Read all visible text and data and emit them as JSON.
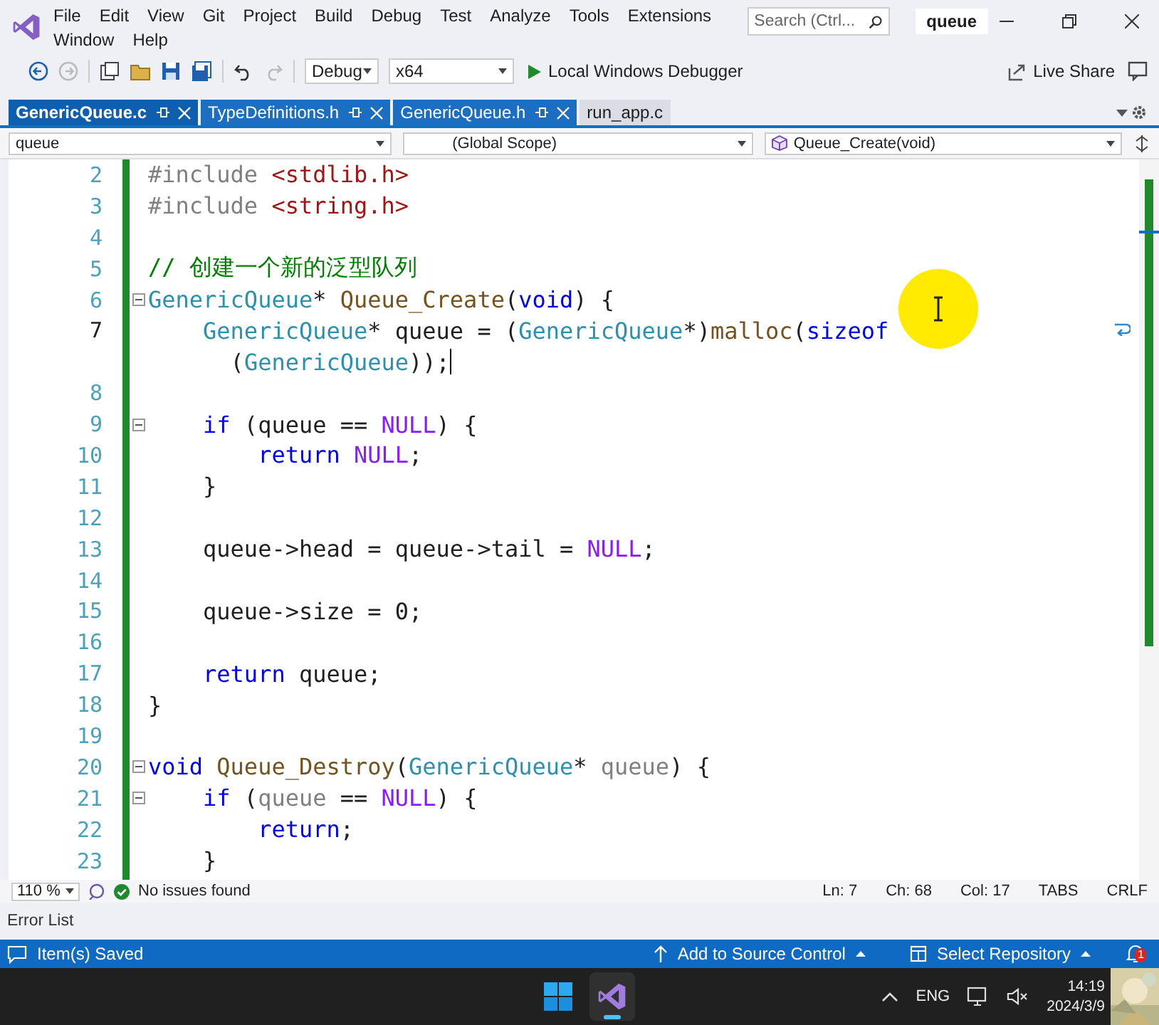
{
  "menu": [
    "File",
    "Edit",
    "View",
    "Git",
    "Project",
    "Build",
    "Debug",
    "Test",
    "Analyze",
    "Tools",
    "Extensions",
    "Window",
    "Help"
  ],
  "search": {
    "placeholder": "Search (Ctrl..."
  },
  "window": {
    "title": "queue"
  },
  "toolbar": {
    "configuration": "Debug",
    "platform": "x64",
    "run_label": "Local Windows Debugger",
    "live_share": "Live Share"
  },
  "tabs": [
    {
      "label": "GenericQueue.c",
      "selected": true,
      "pinned": true
    },
    {
      "label": "TypeDefinitions.h",
      "selected": false,
      "pinned": true
    },
    {
      "label": "GenericQueue.h",
      "selected": false,
      "pinned": true
    },
    {
      "label": "run_app.c",
      "selected": false,
      "pinned": false
    }
  ],
  "nav": {
    "project": "queue",
    "scope": "(Global Scope)",
    "member": "Queue_Create(void)"
  },
  "code": [
    {
      "number": "2",
      "tokens": [
        {
          "kind": "pp",
          "text": "#include"
        },
        {
          "kind": "str",
          "text": " <stdlib.h>"
        }
      ]
    },
    {
      "number": "3",
      "tokens": [
        {
          "kind": "pp",
          "text": "#include"
        },
        {
          "kind": "str",
          "text": " <string.h>"
        }
      ]
    },
    {
      "number": "4"
    },
    {
      "number": "5",
      "tokens": [
        {
          "kind": "cm",
          "text": "// 创建一个新的泛型队列"
        }
      ]
    },
    {
      "number": "6",
      "fold": true,
      "tokens": [
        {
          "kind": "ty",
          "text": "GenericQueue"
        },
        {
          "kind": "plain",
          "text": "* "
        },
        {
          "kind": "fn",
          "text": "Queue_Create"
        },
        {
          "kind": "plain",
          "text": "("
        },
        {
          "kind": "kw",
          "text": "void"
        },
        {
          "kind": "plain",
          "text": ") {"
        }
      ]
    },
    {
      "number": "7",
      "current": true,
      "tokens": [
        {
          "kind": "ty",
          "text": "    GenericQueue"
        },
        {
          "kind": "plain",
          "text": "* queue = ("
        },
        {
          "kind": "ty",
          "text": "GenericQueue"
        },
        {
          "kind": "plain",
          "text": "*)"
        },
        {
          "kind": "fn",
          "text": "malloc"
        },
        {
          "kind": "plain",
          "text": "("
        },
        {
          "kind": "kw",
          "text": "sizeof"
        }
      ],
      "wrap": [
        {
          "kind": "plain",
          "text": "      ("
        },
        {
          "kind": "ty",
          "text": "GenericQueue"
        },
        {
          "kind": "plain",
          "text": "));"
        }
      ]
    },
    {
      "number": "8"
    },
    {
      "number": "9",
      "fold": true,
      "tokens": [
        {
          "kind": "kw",
          "text": "    if"
        },
        {
          "kind": "plain",
          "text": " (queue == "
        },
        {
          "kind": "mac",
          "text": "NULL"
        },
        {
          "kind": "plain",
          "text": ") {"
        }
      ]
    },
    {
      "number": "10",
      "tokens": [
        {
          "kind": "kw",
          "text": "        return"
        },
        {
          "kind": "mac",
          "text": " NULL"
        },
        {
          "kind": "plain",
          "text": ";"
        }
      ]
    },
    {
      "number": "11",
      "tokens": [
        {
          "kind": "plain",
          "text": "    }"
        }
      ]
    },
    {
      "number": "12"
    },
    {
      "number": "13",
      "tokens": [
        {
          "kind": "plain",
          "text": "    queue->head = queue->tail = "
        },
        {
          "kind": "mac",
          "text": "NULL"
        },
        {
          "kind": "plain",
          "text": ";"
        }
      ]
    },
    {
      "number": "14"
    },
    {
      "number": "15",
      "tokens": [
        {
          "kind": "plain",
          "text": "    queue->size = 0;"
        }
      ]
    },
    {
      "number": "16"
    },
    {
      "number": "17",
      "tokens": [
        {
          "kind": "kw",
          "text": "    return"
        },
        {
          "kind": "plain",
          "text": " queue;"
        }
      ]
    },
    {
      "number": "18",
      "tokens": [
        {
          "kind": "plain",
          "text": "}"
        }
      ]
    },
    {
      "number": "19"
    },
    {
      "number": "20",
      "fold": true,
      "tokens": [
        {
          "kind": "kw",
          "text": "void"
        },
        {
          "kind": "fn",
          "text": " Queue_Destroy"
        },
        {
          "kind": "plain",
          "text": "("
        },
        {
          "kind": "ty",
          "text": "GenericQueue"
        },
        {
          "kind": "plain",
          "text": "* "
        },
        {
          "kind": "param",
          "text": "queue"
        },
        {
          "kind": "plain",
          "text": ") {"
        }
      ]
    },
    {
      "number": "21",
      "fold": true,
      "tokens": [
        {
          "kind": "kw",
          "text": "    if"
        },
        {
          "kind": "plain",
          "text": " ("
        },
        {
          "kind": "param",
          "text": "queue"
        },
        {
          "kind": "plain",
          "text": " == "
        },
        {
          "kind": "mac",
          "text": "NULL"
        },
        {
          "kind": "plain",
          "text": ") {"
        }
      ]
    },
    {
      "number": "22",
      "tokens": [
        {
          "kind": "kw",
          "text": "        return"
        },
        {
          "kind": "plain",
          "text": ";"
        }
      ]
    },
    {
      "number": "23",
      "tokens": [
        {
          "kind": "plain",
          "text": "    }"
        }
      ]
    }
  ],
  "editor_status": {
    "zoom": "110 %",
    "issues": "No issues found",
    "ln": "Ln: 7",
    "ch": "Ch: 68",
    "col": "Col: 17",
    "indent": "TABS",
    "eol": "CRLF"
  },
  "panel": {
    "tab": "Error List"
  },
  "status_bar": {
    "message": "Item(s) Saved",
    "source_control": "Add to Source Control",
    "repository": "Select Repository",
    "notifications": "1"
  },
  "taskbar": {
    "language": "ENG",
    "time": "14:19",
    "date": "2024/3/9"
  }
}
